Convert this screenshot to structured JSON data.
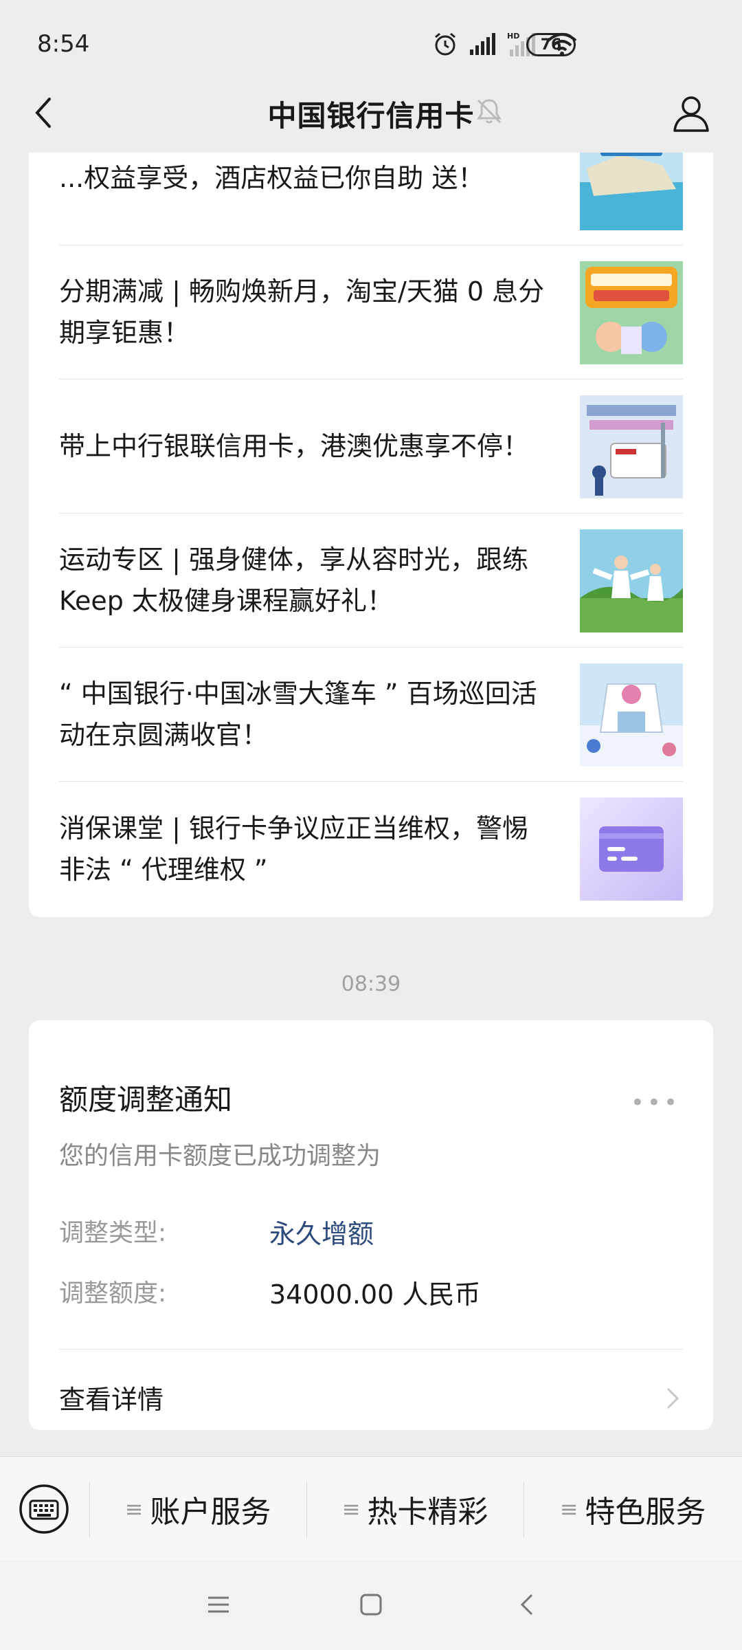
{
  "status_bar": {
    "time": "8:54",
    "battery": "76"
  },
  "nav": {
    "title": "中国银行信用卡"
  },
  "articles": [
    {
      "title": "...权益享受，酒店权益已你自助 送！",
      "thumb": "pool-icon"
    },
    {
      "title": "分期满减 | 畅购焕新月，淘宝/天猫 0 息分期享钜惠！",
      "thumb": "shopping-promo-icon"
    },
    {
      "title": "带上中行银联信用卡，港澳优惠享不停！",
      "thumb": "hk-macau-card-icon"
    },
    {
      "title": "运动专区 | 强身健体，享从容时光，跟练 Keep 太极健身课程赢好礼！",
      "thumb": "taichi-icon"
    },
    {
      "title": "“ 中国银行·中国冰雪大篷车 ” 百场巡回活动在京圆满收官！",
      "thumb": "event-icon"
    },
    {
      "title": "消保课堂 | 银行卡争议应正当维权，警惕非法 “ 代理维权 ”",
      "thumb": "card-icon"
    }
  ],
  "timestamp": "08:39",
  "notice": {
    "title": "额度调整通知",
    "more": "•••",
    "subtitle": "您的信用卡额度已成功调整为",
    "type_label": "调整类型:",
    "type_value": "永久增额",
    "amount_label": "调整额度:",
    "amount_value": "34000.00 人民币",
    "details": "查看详情"
  },
  "bottom_menu": {
    "items": [
      "账户服务",
      "热卡精彩",
      "特色服务"
    ],
    "hamburger": "≡"
  },
  "colors": {
    "accent_blue": "#2c4a7c",
    "background": "#ededed"
  }
}
